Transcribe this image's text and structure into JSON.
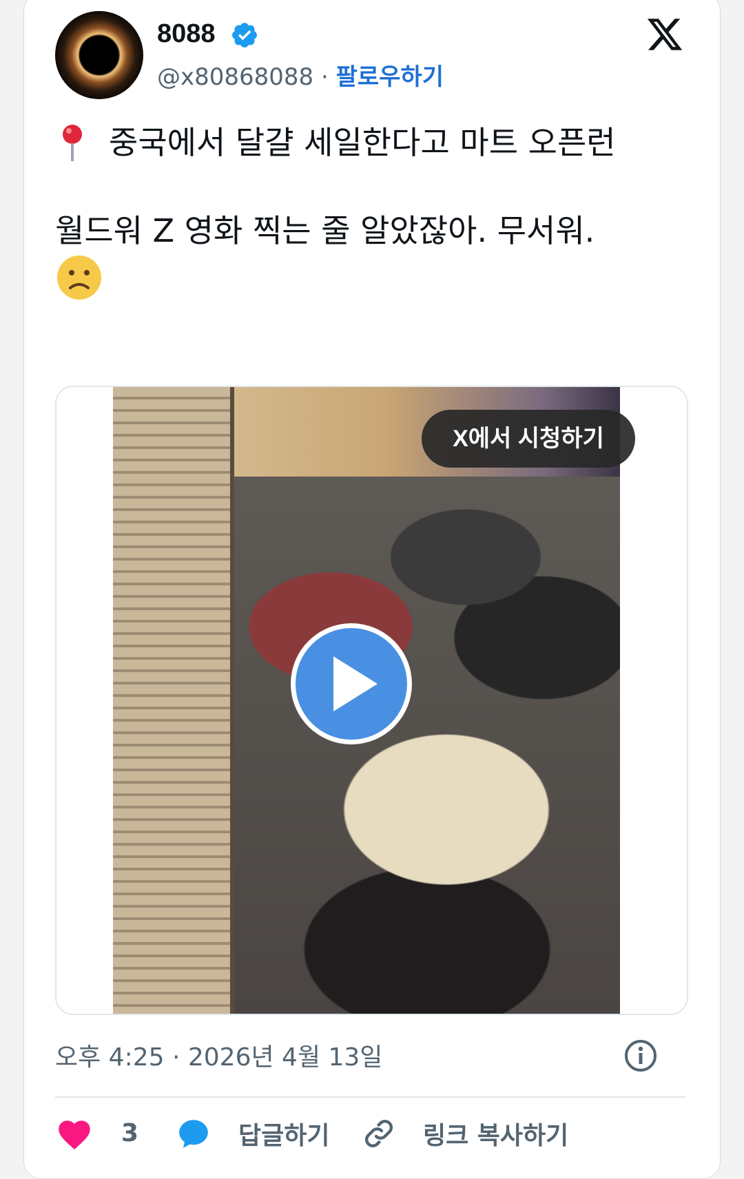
{
  "author": {
    "name": "8088",
    "handle": "@x80868088",
    "separator": "·",
    "follow_label": "팔로우하기"
  },
  "tweet": {
    "line1": "중국에서 달걀 세일한다고 마트 오픈런",
    "line2": "월드워 Z  영화 찍는 줄 알았잖아.  무서워."
  },
  "media": {
    "watch_label": "X에서 시청하기"
  },
  "meta": {
    "timestamp": "오후 4:25 · 2026년 4월 13일"
  },
  "actions": {
    "like_count": "3",
    "reply_label": "답글하기",
    "copy_link_label": "링크 복사하기"
  },
  "colors": {
    "accent": "#1d6fd6",
    "verified": "#1d9bf0",
    "like": "#f91880",
    "play": "#4a90e2"
  },
  "icons": [
    "verified-badge-icon",
    "x-logo-icon",
    "pin-icon",
    "frown-emoji-icon",
    "play-icon",
    "info-icon",
    "heart-icon",
    "reply-icon",
    "link-icon"
  ]
}
